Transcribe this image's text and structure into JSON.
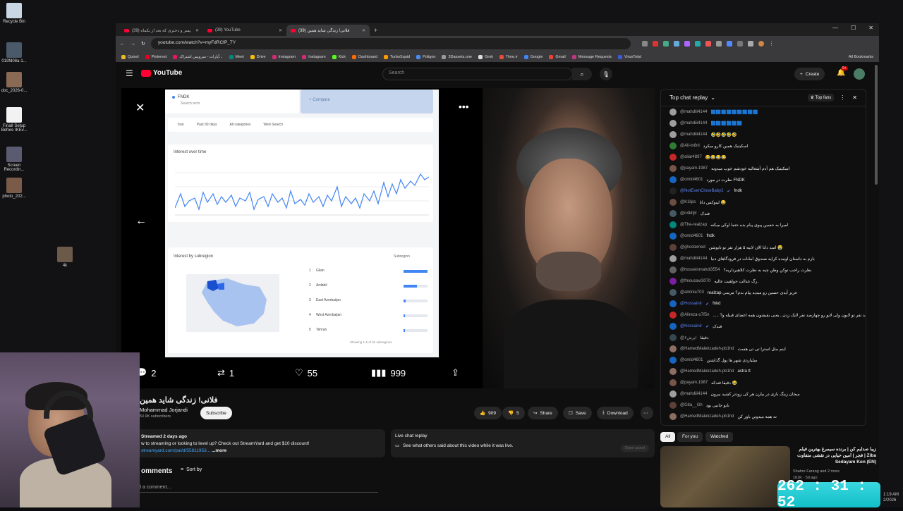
{
  "desktop": {
    "icons": [
      {
        "label": "Recycle Bin"
      },
      {
        "label": "019fd08a-1..."
      },
      {
        "label": "doc_2026-0..."
      },
      {
        "label": "FinalI Setup Before IKEv..."
      },
      {
        "label": "Screen Recordin..."
      },
      {
        "label": "photo_202..."
      },
      {
        "label": "4k"
      }
    ]
  },
  "browser": {
    "tabs": [
      {
        "label": "(39) پسر و دختری که بعد از یکماه"
      },
      {
        "label": "(39) YouTube"
      },
      {
        "label": "(39) فلانی! زندگی شاید همین"
      }
    ],
    "url": "youtube.com/watch?v=myFdRCfP_TY",
    "bookmarks": [
      "Quixel",
      "Pinterest",
      "آپارات - سرویس اشتراک...",
      "Meet",
      "Drive",
      "Instagram",
      "Instagram",
      "Kick",
      "Dashboard",
      "TurboSquid",
      "Poligon",
      "3Dassets.one",
      "Grok",
      "Time.ir",
      "Google",
      "Gmail",
      "Message Requests",
      "VirusTotal",
      "All Bookmarks"
    ]
  },
  "youtube": {
    "logo": "YouTube",
    "search_placeholder": "Search",
    "create": "Create",
    "notif_count": "9+"
  },
  "player": {
    "trends": {
      "term": "FNDK",
      "term_sub": "Search term",
      "compare": "Compare",
      "filters": [
        "Iran",
        "Past 90 days",
        "All categories",
        "Web Search"
      ],
      "interest_over_time": "Interest over time",
      "interest_by_subregion": "Interest by subregion",
      "subregion_select": "Subregion",
      "regions": [
        {
          "rank": "1",
          "name": "Gilan",
          "value": 100
        },
        {
          "rank": "2",
          "name": "Ardabil",
          "value": 55
        },
        {
          "rank": "3",
          "name": "East Azerbaijan",
          "value": 8
        },
        {
          "rank": "4",
          "name": "West Azerbaijan",
          "value": 6
        },
        {
          "rank": "5",
          "name": "Tehran",
          "value": 5
        }
      ],
      "showing": "Showing 1-5 of 31 subregions"
    },
    "stats": {
      "replies": "2",
      "reposts": "1",
      "likes": "55",
      "views": "999"
    }
  },
  "video": {
    "title": "فلانی! زندگی شاید همین",
    "channel": "Mohammad Jorjandi",
    "subscribers": "53.9K subscribers",
    "subscribe": "Subscribe",
    "likes": "909",
    "dislikes": "5",
    "share": "Share",
    "save": "Save",
    "download": "Download",
    "desc_meta": "Streamed 2 days ago",
    "desc_line1": "w to streaming or looking to level up? Check out StreamYard and get $10 discount!",
    "desc_line2": "streamyard.com/pal/d/55811953...",
    "desc_more": "...more",
    "live_title": "Live chat replay",
    "live_text": "See what others said about this video while it was live.",
    "open_panel": "Open panel",
    "comments": "omments",
    "sort": "Sort by",
    "add_comment": "d a comment..."
  },
  "chat": {
    "title": "Top chat replay",
    "top_fans": "Top fans",
    "messages": [
      {
        "author": "@mahdiii4144",
        "text": "🟦🟦🟦🟦🟦🟦🟦🟦🟦",
        "color": "#9e9e9e"
      },
      {
        "author": "@mahdiii4144",
        "text": "🟦🟦🟦🟦🟦🟦",
        "color": "#9e9e9e"
      },
      {
        "author": "@mahdiii4144",
        "text": "🤣🤣🤣🤣🤣",
        "color": "#9e9e9e"
      },
      {
        "author": "@Ali-tn8nl",
        "text": "اسکیتیک همین کارو میکرد",
        "color": "#2e7d32"
      },
      {
        "author": "@aliar4897",
        "text": "😂😂😂😂",
        "color": "#c62828"
      },
      {
        "author": "@payam.1987",
        "text": "اسکیتیک هم آدم آشغالیه خودشم خوب میدونه",
        "color": "#795548"
      },
      {
        "author": "@omid4601",
        "text": "نظرت در مورد FNDK",
        "color": "#1565c0"
      },
      {
        "author": "@NotEvenCloseBaby2",
        "text": "fndk",
        "color": "#222",
        "mod": true
      },
      {
        "author": "@K1lips",
        "text": "لینوکس دانا 😂",
        "color": "#6d4c41"
      },
      {
        "author": "@n4khjlr",
        "text": "فندک",
        "color": "#455a64"
      },
      {
        "author": "@The-realzap",
        "text": "امیرا به حسین پیوی پیام بده حتما اوکی میکنه",
        "color": "#00897b"
      },
      {
        "author": "@omid4601",
        "text": "fndk",
        "color": "#1565c0"
      },
      {
        "author": "@ghostemed",
        "text": "امید دانا الان لابیه ۵ هزار نفر تو تایوشن 😭",
        "color": "#5d4037"
      },
      {
        "author": "@mahdiii4144",
        "text": "بازم به داستان اومده کرایه صندوق امانات در فرودگاهای دنیا",
        "color": "#9e9e9e"
      },
      {
        "author": "@hosseinmahdi3554",
        "text": "نظرت راجب توکن وطن چیه به نظرت کلاهبرداریه؟",
        "color": "#616161"
      },
      {
        "author": "@fmousavi3070",
        "text": "رگ عدالت خواهیت عالیه.",
        "color": "#7b1fa2"
      },
      {
        "author": "@aminia703",
        "text": "realzap عزیز آیدی حسین رو میدید پیام بدم؟ مرسی",
        "color": "#455a64"
      },
      {
        "author": "@Hossainir",
        "text": "fnkd",
        "color": "#1565c0",
        "mod": true
      },
      {
        "author": "@Alireza-o7f5n",
        "text": "..... ?انصد نفر تو لایون ولی لایو رو چهارصد نفر لایک زدن , یعنی بقیشون همه اعضای قبیله و",
        "color": "#c62828"
      },
      {
        "author": "@Hossainir",
        "text": "فندک",
        "color": "#1565c0",
        "mod": true
      },
      {
        "author": "@ایرش۶",
        "text": "دقیقا",
        "color": "#37474f"
      },
      {
        "author": "@HamedMalekzadeh-pb1hd",
        "text": "اینم مثل استرا تی تی هست",
        "color": "#8d6e63"
      },
      {
        "author": "@omid4601",
        "text": "میلیاردی شهر ها پول گذاشتن",
        "color": "#1565c0"
      },
      {
        "author": "@HamedMalekzadeh-pb1hd",
        "text": "astra tt",
        "color": "#8d6e63"
      },
      {
        "author": "@payam.1987",
        "text": "دقیقا فندکه 😂",
        "color": "#795548"
      },
      {
        "author": "@mahdiii4144",
        "text": "میخان زینگ بازی در بیارن هر کی زودتر کشید بیرون",
        "color": "#9e9e9e"
      },
      {
        "author": "@Gita__Gh",
        "text": "نابو جانبی بود",
        "color": "#5d4037"
      },
      {
        "author": "@HamedMalekzadeh-pb1hd",
        "text": "نه همه میدونن باور کن",
        "color": "#8d6e63"
      }
    ]
  },
  "sidebar": {
    "chips": [
      "All",
      "For you",
      "Watched"
    ],
    "rec_title": "زیبا صدایم کن | برنده سیمرغ بهترین فیلم فجر | امین حیایی در نقشی متفاوت | Ziba Sedayam Kon (EN)",
    "rec_channel": "Shahre Farang",
    "rec_meta": "161K · 5d ago",
    "rec_extra": "and 2 more"
  },
  "overlay": {
    "timer": "262 : 31 : 52",
    "clock": "1:19 AM",
    "date": "2/2026"
  }
}
